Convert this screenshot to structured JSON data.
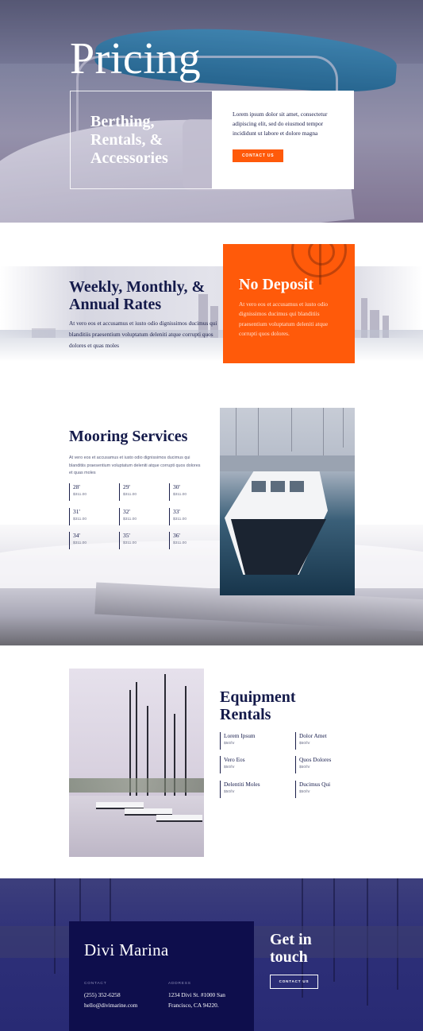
{
  "hero": {
    "title": "Pricing",
    "subtitle": "Berthing, Rentals, & Accessories",
    "card_text": "Lorem ipsum dolor sit amet, consectetur adipiscing elit, sed do eiusmod tempor incididunt ut labore et dolore magna",
    "button_label": "CONTACT US"
  },
  "rates": {
    "title": "Weekly, Monthly, & Annual Rates",
    "text": "At vero eos et accusamus et iusto odio dignissimos ducimus qui blanditiis praesentium voluptatum deleniti atque corrupti quos dolores et quas moles",
    "deposit_title": "No Deposit",
    "deposit_text": "At vero eos et accusamus et iusto odio dignissimos ducimus qui blanditiis praesentium voluptatum deleniti atque corrupti quos dolores."
  },
  "mooring": {
    "title": "Mooring Services",
    "text": "At vero eos et accusamus et iusto odio dignissimos ducimus qui blanditiis praesentium voluptatum deleniti atque corrupti quos dolores et quas moles",
    "items": [
      {
        "size": "28'",
        "price": "$311.00"
      },
      {
        "size": "29'",
        "price": "$311.00"
      },
      {
        "size": "30'",
        "price": "$311.00"
      },
      {
        "size": "31'",
        "price": "$311.00"
      },
      {
        "size": "32'",
        "price": "$311.00"
      },
      {
        "size": "33'",
        "price": "$311.00"
      },
      {
        "size": "34'",
        "price": "$311.00"
      },
      {
        "size": "35'",
        "price": "$311.00"
      },
      {
        "size": "36'",
        "price": "$311.00"
      }
    ]
  },
  "equipment": {
    "title": "Equipment Rentals",
    "items": [
      {
        "name": "Lorem Ipsum",
        "price": "$50/hr"
      },
      {
        "name": "Dolor Amet",
        "price": "$50/hr"
      },
      {
        "name": "Vero Eos",
        "price": "$50/hr"
      },
      {
        "name": "Quos Dolores",
        "price": "$50/hr"
      },
      {
        "name": "Delentiti Moles",
        "price": "$50/hr"
      },
      {
        "name": "Ducimus Qui",
        "price": "$50/hr"
      }
    ]
  },
  "footer": {
    "brand": "Divi Marina",
    "contact_label": "CONTACT",
    "phone": "(255) 352-6258",
    "email": "hello@divimarine.com",
    "address_label": "ADDRESS",
    "address_line1": "1234 Divi St. #1000 San",
    "address_line2": "Francisco, CA 94220.",
    "cta_title": "Get in touch",
    "cta_button": "CONTACT US"
  },
  "colors": {
    "accent": "#ff5a0a",
    "navy": "#141a4a",
    "footer_card": "#0e0e4c"
  }
}
